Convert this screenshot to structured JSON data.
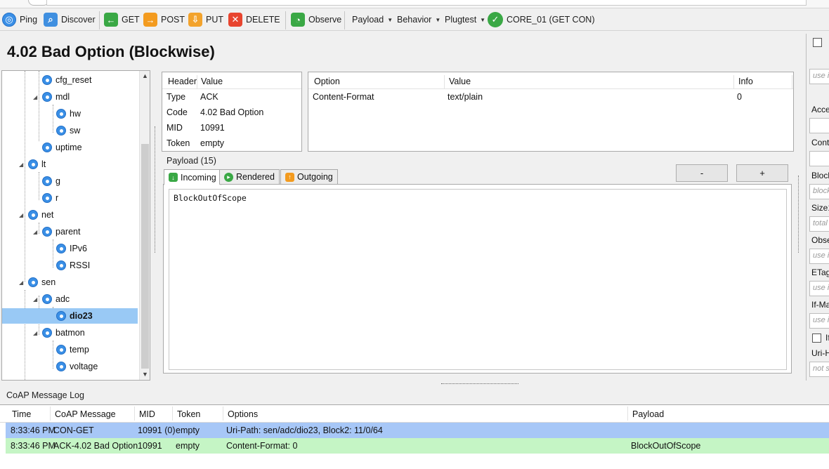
{
  "toolbar": {
    "ping": "Ping",
    "discover": "Discover",
    "get": "GET",
    "post": "POST",
    "put": "PUT",
    "delete": "DELETE",
    "observe": "Observe",
    "payload_menu": "Payload",
    "behavior_menu": "Behavior",
    "plugtest_menu": "Plugtest",
    "status": "CORE_01 (GET CON)"
  },
  "response_title": "4.02 Bad Option (Blockwise)",
  "tree": {
    "items": [
      {
        "label": "cfg_reset"
      },
      {
        "label": "mdl"
      },
      {
        "label": "hw"
      },
      {
        "label": "sw"
      },
      {
        "label": "uptime"
      },
      {
        "label": "lt"
      },
      {
        "label": "g"
      },
      {
        "label": "r"
      },
      {
        "label": "net"
      },
      {
        "label": "parent"
      },
      {
        "label": "IPv6"
      },
      {
        "label": "RSSI"
      },
      {
        "label": "sen"
      },
      {
        "label": "adc"
      },
      {
        "label": "dio23"
      },
      {
        "label": "batmon"
      },
      {
        "label": "temp"
      },
      {
        "label": "voltage"
      }
    ]
  },
  "header_table": {
    "col_header": "Header",
    "col_value": "Value",
    "rows": [
      {
        "key": "Type",
        "value": "ACK"
      },
      {
        "key": "Code",
        "value": "4.02 Bad Option"
      },
      {
        "key": "MID",
        "value": "10991"
      },
      {
        "key": "Token",
        "value": "empty"
      }
    ]
  },
  "options_table": {
    "col_option": "Option",
    "col_value": "Value",
    "col_info": "Info",
    "rows": [
      {
        "option": "Content-Format",
        "value": "text/plain",
        "info": "0"
      }
    ]
  },
  "payload": {
    "label": "Payload (15)",
    "tabs": [
      "Incoming",
      "Rendered",
      "Outgoing"
    ],
    "minus": "-",
    "plus": "+",
    "text": "BlockOutOfScope"
  },
  "right_panel": {
    "labels": {
      "accept": "Acce",
      "content": "Cont",
      "block": "Block",
      "size1": "Size1",
      "observe": "Obse",
      "etag": "ETag",
      "ifmatch": "If-Ma",
      "ifnone": "If",
      "urihost": "Uri-H"
    },
    "placeholders": {
      "top": "use i",
      "block": "block",
      "size1": "total",
      "observe": "use i",
      "etag": "use i",
      "ifmatch": "use i",
      "urihost": "not s"
    }
  },
  "log": {
    "label": "CoAP Message Log",
    "columns": [
      "Time",
      "CoAP Message",
      "MID",
      "Token",
      "Options",
      "Payload"
    ],
    "rows": [
      {
        "time": "8:33:46 PM",
        "message": "CON-GET",
        "mid": "10991 (0)",
        "token": "empty",
        "options": "Uri-Path: sen/adc/dio23, Block2: 11/0/64",
        "payload": "",
        "color": "#a7c7f7"
      },
      {
        "time": "8:33:46 PM",
        "message": "ACK-4.02 Bad Option",
        "mid": "10991",
        "token": "empty",
        "options": "Content-Format: 0",
        "payload": "BlockOutOfScope",
        "color": "#c5f5c5"
      }
    ]
  },
  "colors": {
    "accent_blue": "#3a8fe6",
    "selection": "#99c9f5",
    "get_green": "#3aa845",
    "post_orange": "#f39b1f",
    "delete_red": "#e8452f"
  }
}
